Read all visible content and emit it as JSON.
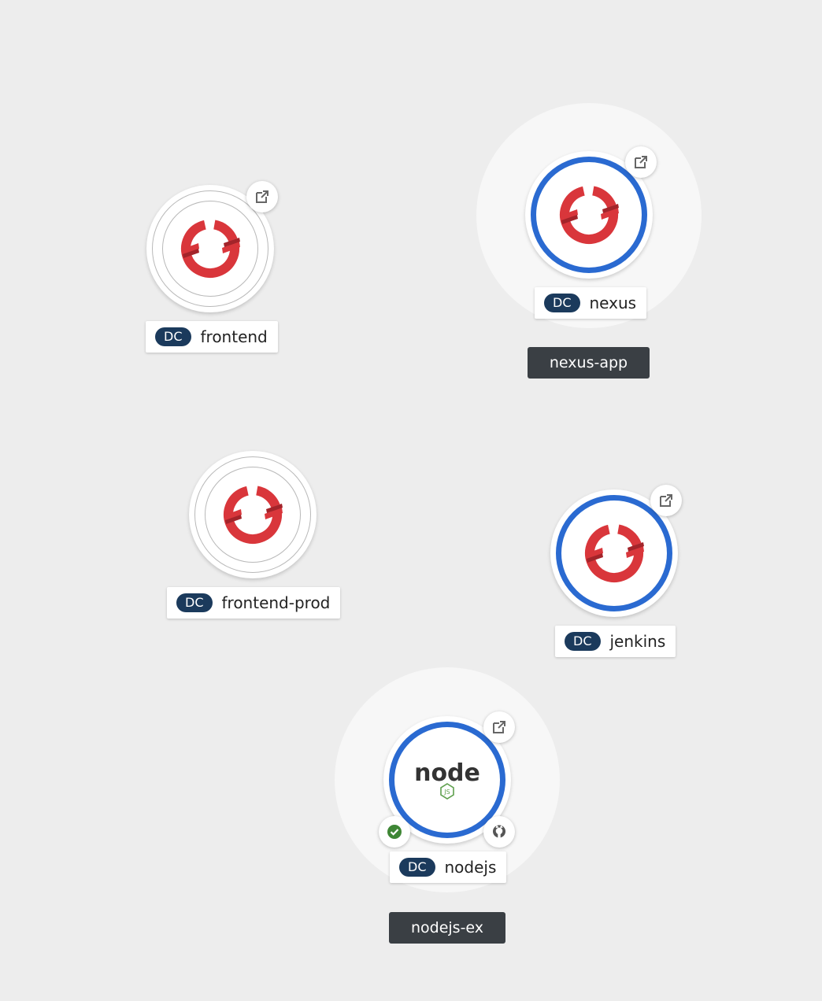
{
  "topology": {
    "groups": [
      {
        "id": "nexus-app",
        "label": "nexus-app"
      },
      {
        "id": "nodejs-ex",
        "label": "nodejs-ex"
      }
    ],
    "nodes": [
      {
        "id": "frontend",
        "kind": "DC",
        "name": "frontend",
        "status": "idle",
        "icon": "openshift-icon",
        "decorators": [
          "open-url-icon"
        ]
      },
      {
        "id": "nexus",
        "kind": "DC",
        "name": "nexus",
        "status": "running",
        "icon": "openshift-icon",
        "decorators": [
          "open-url-icon"
        ]
      },
      {
        "id": "frontend-prod",
        "kind": "DC",
        "name": "frontend-prod",
        "status": "idle",
        "icon": "openshift-icon",
        "decorators": []
      },
      {
        "id": "jenkins",
        "kind": "DC",
        "name": "jenkins",
        "status": "running",
        "icon": "openshift-icon",
        "decorators": [
          "open-url-icon"
        ]
      },
      {
        "id": "nodejs",
        "kind": "DC",
        "name": "nodejs",
        "status": "running",
        "icon": "nodejs-icon",
        "logo_text": "node",
        "logo_subtext": "JS",
        "decorators": [
          "open-url-icon",
          "build-success-icon",
          "github-icon"
        ]
      }
    ]
  },
  "colors": {
    "background": "#ededed",
    "running_ring": "#2a6ad1",
    "badge": "#1b3a5c",
    "group_label": "#3a3f44",
    "openshift_red": "#d9363b",
    "success_green": "#3e8635"
  }
}
